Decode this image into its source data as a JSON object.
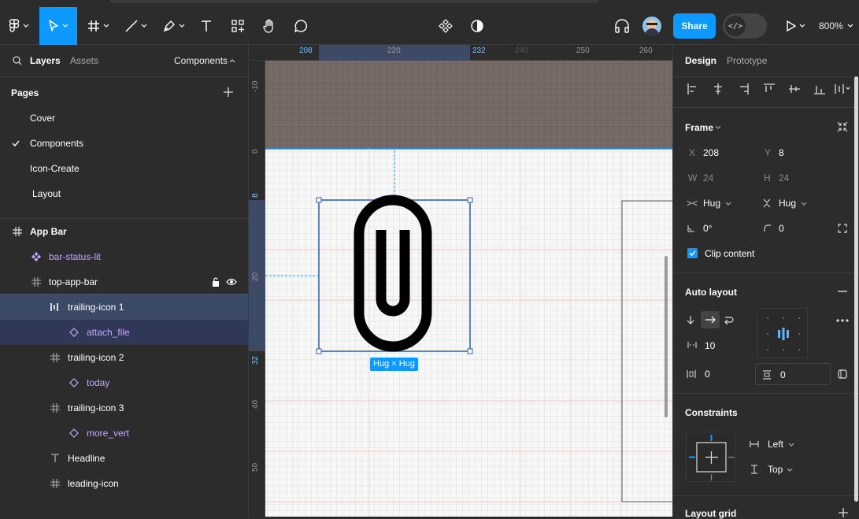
{
  "toolbar": {
    "share_label": "Share",
    "dev_label": "</>",
    "zoom": "800%"
  },
  "left_panel": {
    "tabs": [
      "Layers",
      "Assets"
    ],
    "components_label": "Components",
    "pages_heading": "Pages",
    "pages": [
      "Cover",
      "Components",
      "Icon-Create",
      "Layout"
    ],
    "layers": [
      {
        "label": "App Bar"
      },
      {
        "label": "bar-status-lit"
      },
      {
        "label": "top-app-bar"
      },
      {
        "label": "trailing-icon 1"
      },
      {
        "label": "attach_file"
      },
      {
        "label": "trailing-icon 2"
      },
      {
        "label": "today"
      },
      {
        "label": "trailing-icon 3"
      },
      {
        "label": "more_vert"
      },
      {
        "label": "Headline"
      },
      {
        "label": "leading-icon"
      }
    ]
  },
  "canvas": {
    "ruler_top": [
      "208",
      "220",
      "232",
      "240",
      "250",
      "260"
    ],
    "ruler_left": [
      "-10",
      "0",
      "8",
      "20",
      "32",
      "40",
      "50"
    ],
    "size_badge": "Hug × Hug"
  },
  "right_panel": {
    "tabs": [
      "Design",
      "Prototype"
    ],
    "frame_label": "Frame",
    "x_label": "X",
    "x_value": "208",
    "y_label": "Y",
    "y_value": "8",
    "w_label": "W",
    "w_value": "24",
    "h_label": "H",
    "h_value": "24",
    "hug_w": "Hug",
    "hug_h": "Hug",
    "rotation": "0°",
    "radius": "0",
    "clip_content": "Clip content",
    "auto_layout_label": "Auto layout",
    "gap": "10",
    "padding_h": "0",
    "padding_v": "0",
    "constraints_label": "Constraints",
    "constraint_h": "Left",
    "constraint_v": "Top",
    "layout_grid_label": "Layout grid"
  },
  "colors": {
    "accent": "#0d99ff",
    "component_purple": "#c7a7ff",
    "selection": "#3a4a66"
  }
}
